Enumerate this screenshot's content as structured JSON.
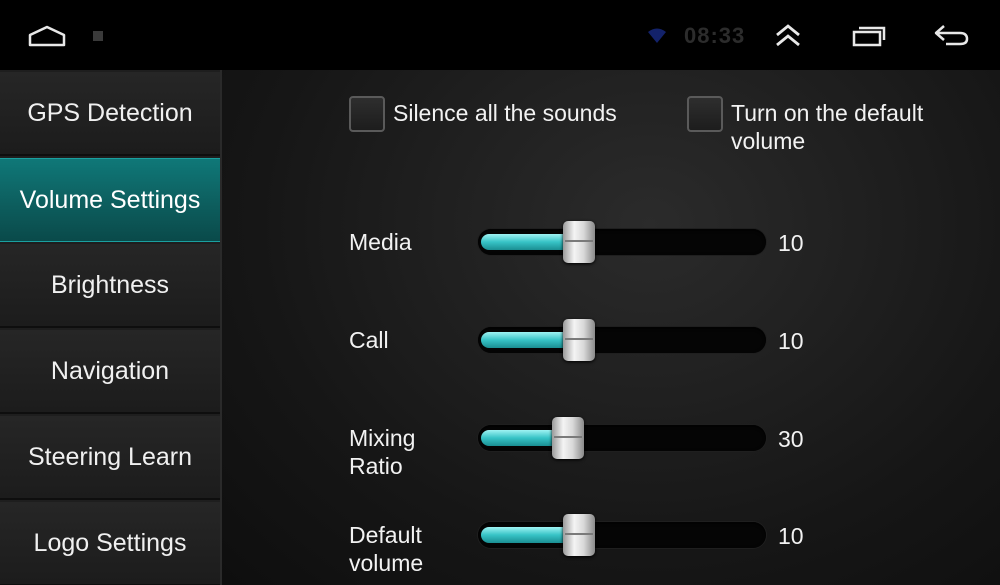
{
  "status_bar": {
    "time": "08:33",
    "icons": [
      "home-icon",
      "notification-icon",
      "wifi-icon",
      "double-chevron-up-icon",
      "recent-apps-icon",
      "back-arrow-icon"
    ]
  },
  "sidebar": {
    "items": [
      {
        "label": "GPS Detection",
        "active": false
      },
      {
        "label": "Volume Settings",
        "active": true
      },
      {
        "label": "Brightness",
        "active": false
      },
      {
        "label": "Navigation",
        "active": false
      },
      {
        "label": "Steering Learn",
        "active": false
      },
      {
        "label": "Logo Settings",
        "active": false
      }
    ]
  },
  "options": {
    "silence": {
      "label": "Silence all the sounds",
      "checked": false
    },
    "default_volume": {
      "label": "Turn on the default volume",
      "checked": false
    }
  },
  "sliders": [
    {
      "label": "Media",
      "value": "10",
      "fraction": 0.33
    },
    {
      "label": "Call",
      "value": "10",
      "fraction": 0.33
    },
    {
      "label": "Mixing Ratio",
      "value": "30",
      "fraction": 0.29
    },
    {
      "label": "Default volume",
      "value": "10",
      "fraction": 0.33
    }
  ],
  "colors": {
    "accent": "#0d6868",
    "slider_fill": "#37c3c6",
    "background": "#000000"
  }
}
